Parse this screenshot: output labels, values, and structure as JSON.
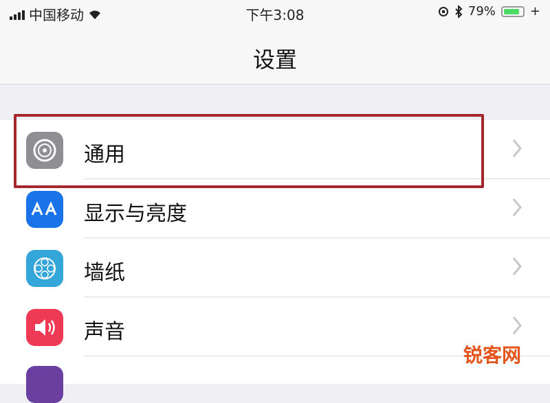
{
  "status_bar": {
    "carrier": "中国移动",
    "time": "下午3:08",
    "battery": "79%"
  },
  "nav": {
    "title": "设置"
  },
  "list": [
    {
      "label": "通用",
      "icon": "gear-icon",
      "color": "#8e8e93"
    },
    {
      "label": "显示与亮度",
      "icon": "text-size-icon",
      "color": "#1a73e8"
    },
    {
      "label": "墙纸",
      "icon": "wallpaper-icon",
      "color": "#35a6d9"
    },
    {
      "label": "声音",
      "icon": "speaker-icon",
      "color": "#ee3a55"
    }
  ],
  "highlighted_item": "通用",
  "watermark": "锐客网"
}
